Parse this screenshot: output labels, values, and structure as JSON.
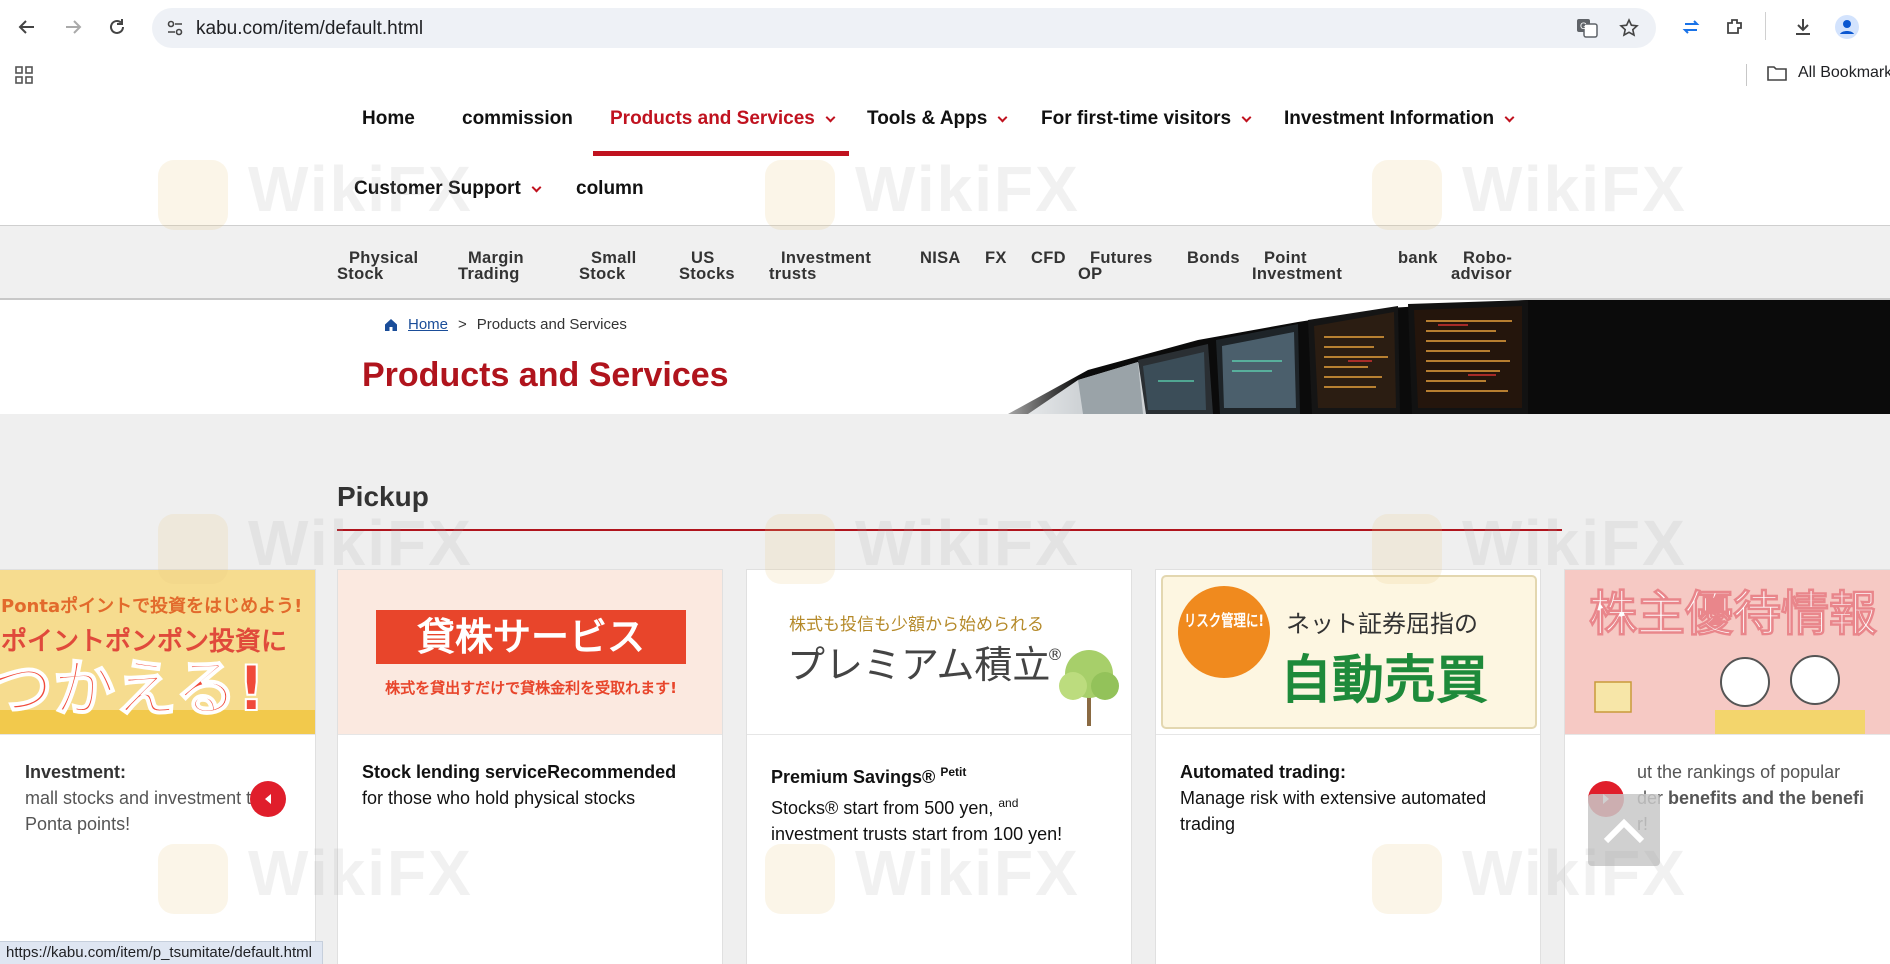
{
  "browser": {
    "url": "kabu.com/item/default.html",
    "bookmarks_label": "All Bookmarks",
    "status_url": "https://kabu.com/item/p_tsumitate/default.html"
  },
  "global_nav": {
    "row1": [
      {
        "label": "Home",
        "has_menu": false,
        "active": false
      },
      {
        "label": "commission",
        "has_menu": false,
        "active": false
      },
      {
        "label": "Products and Services",
        "has_menu": true,
        "active": true
      },
      {
        "label": "Tools & Apps",
        "has_menu": true,
        "active": false
      },
      {
        "label": "For first-time visitors",
        "has_menu": true,
        "active": false
      },
      {
        "label": "Investment Information",
        "has_menu": true,
        "active": false
      }
    ],
    "row2": [
      {
        "label": "Customer Support",
        "has_menu": true
      },
      {
        "label": "column",
        "has_menu": false
      }
    ]
  },
  "sub_nav": [
    {
      "line1": "Physical",
      "line2": "Stock"
    },
    {
      "line1": "Margin",
      "line2": "Trading"
    },
    {
      "line1": "Small",
      "line2": "Stock"
    },
    {
      "line1": "US",
      "line2": "Stocks"
    },
    {
      "line1": "Investment",
      "line2": "trusts"
    },
    {
      "line1": "NISA",
      "line2": ""
    },
    {
      "line1": "FX",
      "line2": ""
    },
    {
      "line1": "CFD",
      "line2": ""
    },
    {
      "line1": "Futures",
      "line2": "OP"
    },
    {
      "line1": "Bonds",
      "line2": ""
    },
    {
      "line1": "Point",
      "line2": "Investment"
    },
    {
      "line1": "bank",
      "line2": ""
    },
    {
      "line1": "Robo-",
      "line2": "advisor"
    }
  ],
  "breadcrumb": {
    "home": "Home",
    "separator": ">",
    "current": "Products and Services"
  },
  "page_title": "Products and Services",
  "pickup": {
    "title": "Pickup",
    "cards": [
      {
        "banner_line1": "Pontaポイントで投資をはじめよう!",
        "banner_line2": "ポイントポンポン投資に",
        "banner_line3": "つかえる!",
        "head": "Investment:",
        "text": "mall stocks and investment trus",
        "text2": "Ponta points!"
      },
      {
        "banner_main": "貸株サービス",
        "banner_sub": "株式を貸出すだけで貸株金利を受取れます!",
        "head": "Stock lending serviceRecommended",
        "text": "for those who hold physical stocks"
      },
      {
        "banner_top": "株式も投信も少額から始められる",
        "banner_main": "プレミアム積立",
        "banner_reg": "®",
        "head": "Premium Savings®",
        "head_sup": "Petit",
        "text_a": "Stocks® start from 500 yen,",
        "text_sup": "and",
        "text_b": "investment trusts start from 100 yen!"
      },
      {
        "banner_badge": "リスク管理に!",
        "banner_top": "ネット証券屈指の",
        "banner_main": "自動売買",
        "head": "Automated trading:",
        "text": "Manage risk with extensive automated trading"
      },
      {
        "banner_main": "株主優待情報",
        "text_a": "ut the rankings of popular",
        "text_b": "der",
        "text_bold": "benefits and the benefi",
        "text_c": "r!"
      }
    ]
  },
  "watermark": "WikiFX",
  "colors": {
    "brand_red": "#c0121f",
    "title_red": "#b0141d",
    "sub_nav_bg": "#f0f0f0",
    "main_bg": "#efefef"
  }
}
